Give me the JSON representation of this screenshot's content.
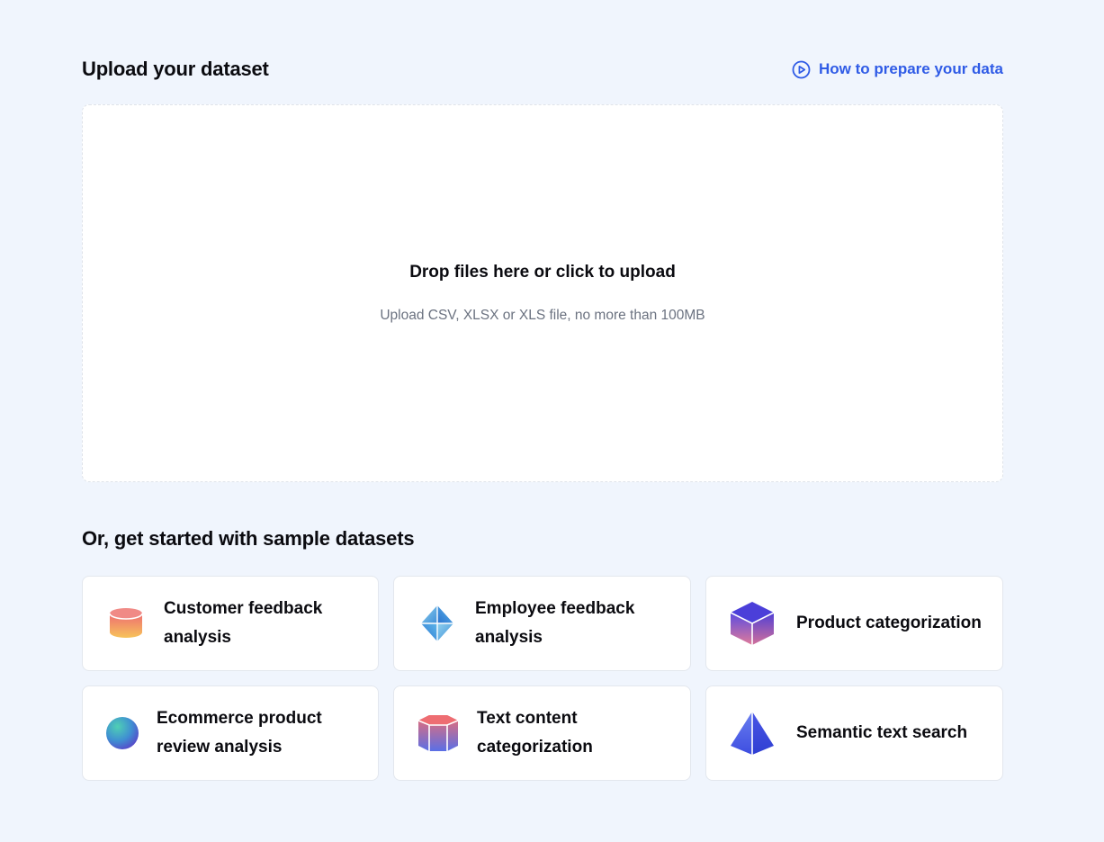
{
  "upload": {
    "title": "Upload your dataset",
    "help_link": "How to prepare your data",
    "dropzone_title": "Drop files here or click to upload",
    "dropzone_subtitle": "Upload CSV, XLSX or XLS file, no more than 100MB"
  },
  "samples": {
    "title": "Or, get started with sample datasets",
    "items": [
      {
        "label": "Customer feedback analysis",
        "icon": "cylinder-icon"
      },
      {
        "label": "Employee feedback analysis",
        "icon": "octahedron-icon"
      },
      {
        "label": "Product categorization",
        "icon": "cube-icon"
      },
      {
        "label": "Ecommerce product review analysis",
        "icon": "sphere-icon"
      },
      {
        "label": "Text content categorization",
        "icon": "hexagonal-prism-icon"
      },
      {
        "label": "Semantic text search",
        "icon": "pyramid-icon"
      }
    ]
  },
  "colors": {
    "background": "#f0f5fd",
    "link": "#2f5be6",
    "muted_text": "#6b7280"
  }
}
